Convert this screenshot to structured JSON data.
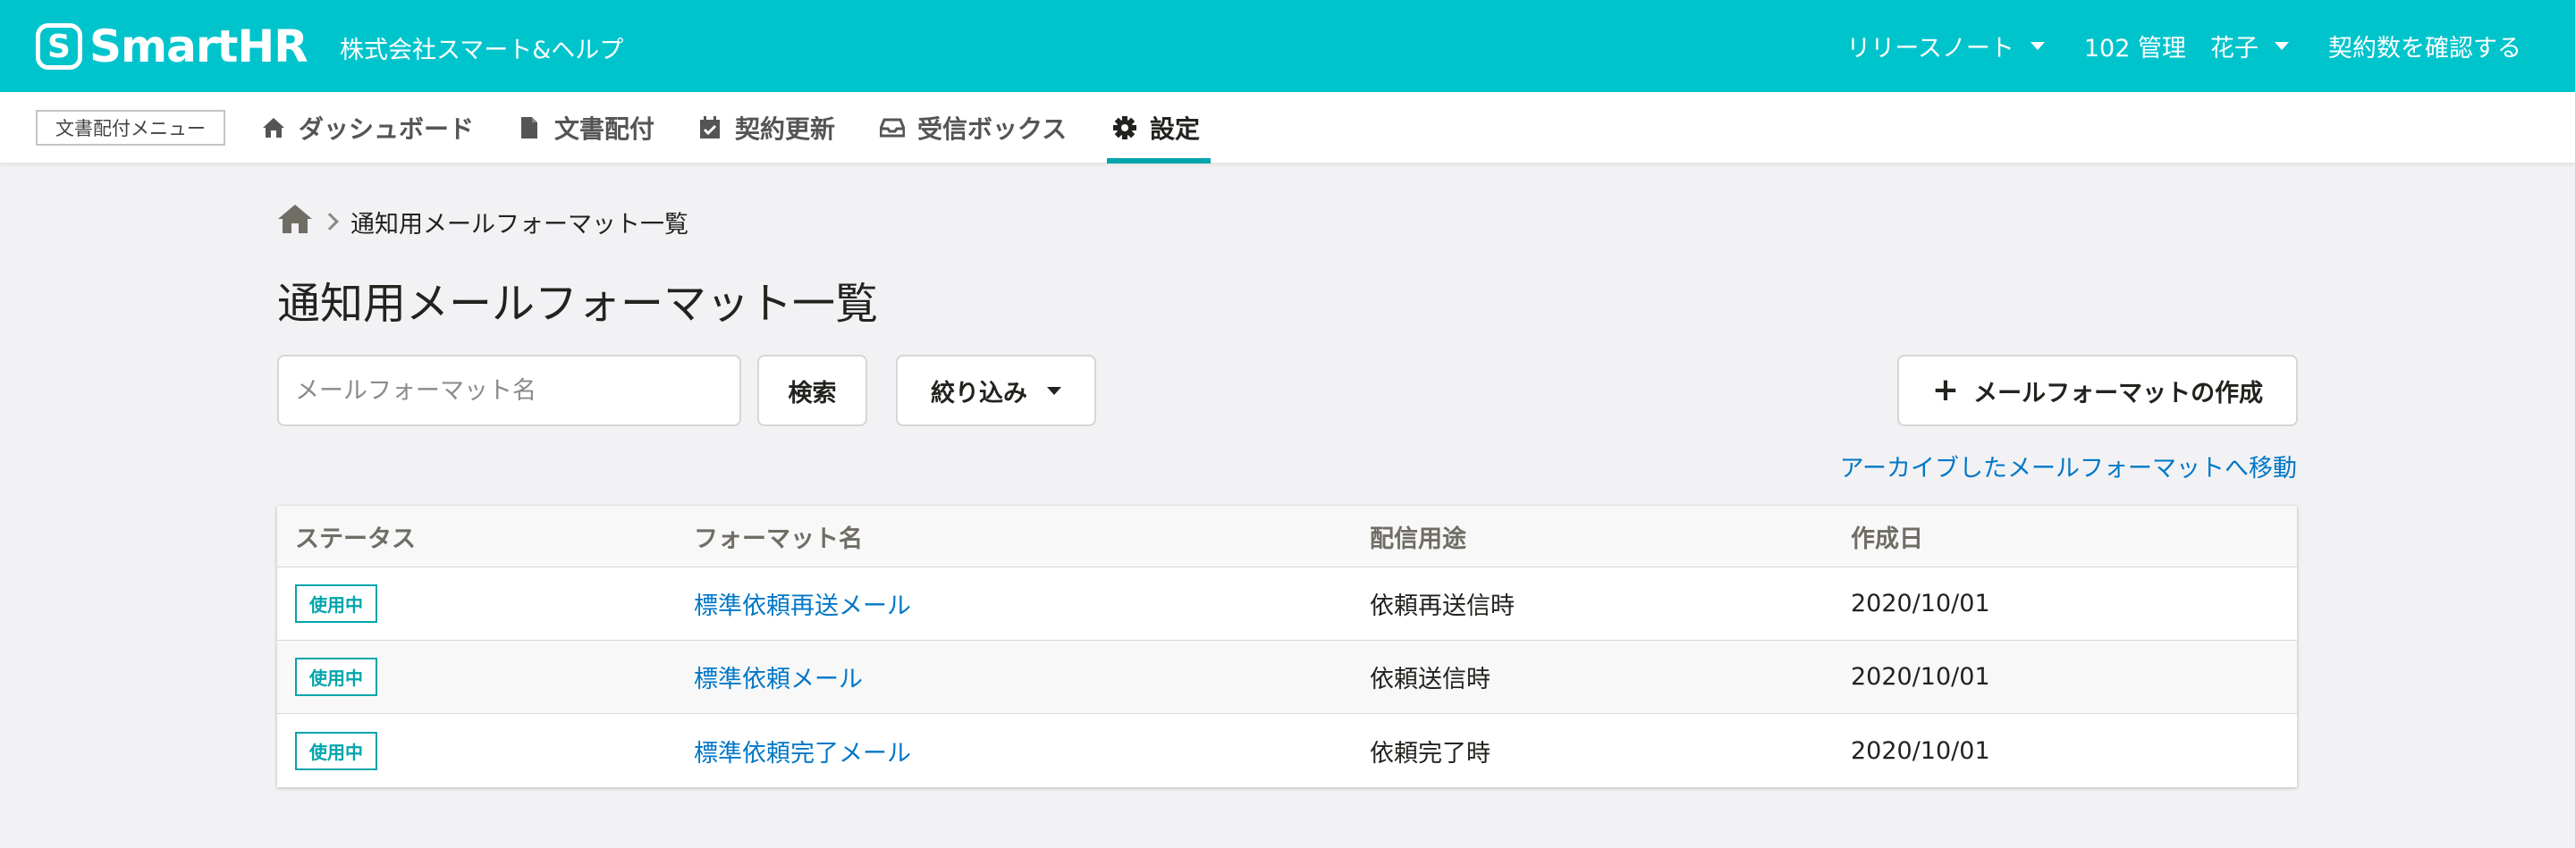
{
  "header": {
    "logo_mark": "S",
    "logo_text": "SmartHR",
    "company": "株式会社スマート&ヘルプ",
    "release_notes": "リリースノート",
    "user": "102 管理　花子",
    "check_contracts": "契約数を確認する"
  },
  "nav": {
    "menu_label": "文書配付メニュー",
    "items": [
      {
        "label": "ダッシュボード",
        "icon": "home-icon"
      },
      {
        "label": "文書配付",
        "icon": "document-icon"
      },
      {
        "label": "契約更新",
        "icon": "calendar-check-icon"
      },
      {
        "label": "受信ボックス",
        "icon": "inbox-icon"
      },
      {
        "label": "設定",
        "icon": "gear-icon",
        "active": true
      }
    ]
  },
  "breadcrumb": {
    "home_icon": "home-icon",
    "current": "通知用メールフォーマット一覧"
  },
  "page": {
    "title": "通知用メールフォーマット一覧"
  },
  "search": {
    "placeholder": "メールフォーマット名",
    "value": "",
    "search_button": "検索",
    "filter_button": "絞り込み"
  },
  "actions": {
    "create_button": "メールフォーマットの作成",
    "archive_link": "アーカイブしたメールフォーマットへ移動"
  },
  "table": {
    "columns": [
      "ステータス",
      "フォーマット名",
      "配信用途",
      "作成日"
    ],
    "rows": [
      {
        "status": "使用中",
        "name": "標準依頼再送メール",
        "usage": "依頼再送信時",
        "created": "2020/10/01"
      },
      {
        "status": "使用中",
        "name": "標準依頼メール",
        "usage": "依頼送信時",
        "created": "2020/10/01"
      },
      {
        "status": "使用中",
        "name": "標準依頼完了メール",
        "usage": "依頼完了時",
        "created": "2020/10/01"
      }
    ]
  },
  "colors": {
    "brand": "#00c4cc",
    "accent": "#00a5ab",
    "link": "#0077c7"
  }
}
